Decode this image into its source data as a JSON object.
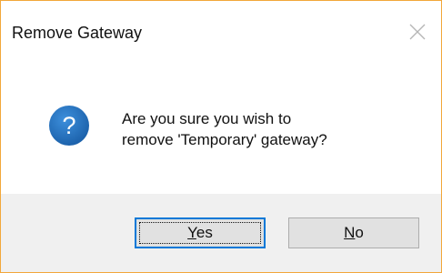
{
  "dialog": {
    "title": "Remove Gateway",
    "message_line1": "Are you sure you wish to",
    "message_line2": "remove 'Temporary' gateway?",
    "icon": "question-icon",
    "close_icon": "close-icon"
  },
  "buttons": {
    "yes": {
      "mnemonic": "Y",
      "rest": "es"
    },
    "no": {
      "mnemonic": "N",
      "rest": "o"
    }
  },
  "colors": {
    "border_accent": "#f2a73a",
    "icon_blue": "#1e6fbf",
    "focus_blue": "#0078d7",
    "footer_bg": "#f0f0f0",
    "button_bg": "#e1e1e1"
  }
}
